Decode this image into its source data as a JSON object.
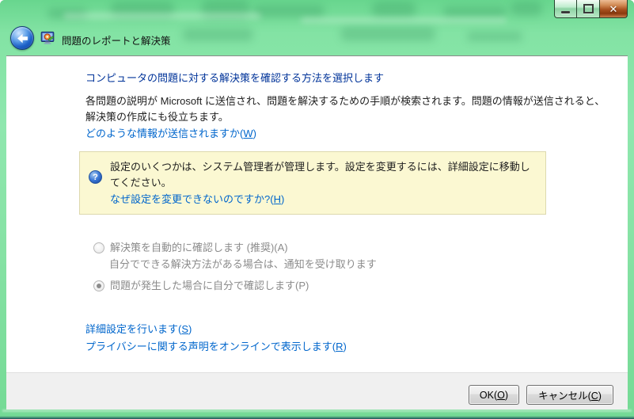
{
  "window": {
    "title": "問題のレポートと解決策",
    "icons": {
      "close_glyph": "✕",
      "help_glyph": "?"
    }
  },
  "content": {
    "heading": "コンピュータの問題に対する解決策を確認する方法を選択します",
    "body": "各問題の説明が Microsoft に送信され、問題を解決するための手順が検索されます。問題の情報が送信されると、解決策の作成にも役立ちます。",
    "what_info_link": {
      "prefix": "どのような情報が送信されますか(",
      "key": "W",
      "suffix": ")"
    },
    "admin_notice": {
      "text": "設定のいくつかは、システム管理者が管理します。設定を変更するには、詳細設定に移動してください。",
      "link": {
        "prefix": "なぜ設定を変更できないのですか?(",
        "key": "H",
        "suffix": ")"
      }
    },
    "options": [
      {
        "prefix": "解決策を自動的に確認します (推奨)(",
        "key": "A",
        "suffix": ")",
        "selected": false,
        "disabled": true,
        "description": "自分でできる解決方法がある場合は、通知を受け取ります"
      },
      {
        "prefix": "問題が発生した場合に自分で確認します(",
        "key": "P",
        "suffix": ")",
        "selected": true,
        "disabled": true
      }
    ],
    "advanced_link": {
      "prefix": "詳細設定を行います(",
      "key": "S",
      "suffix": ")"
    },
    "privacy_link": {
      "prefix": "プライバシーに関する声明をオンラインで表示します(",
      "key": "R",
      "suffix": ")"
    }
  },
  "footer": {
    "ok_button": {
      "prefix": "OK(",
      "key": "O",
      "suffix": ")"
    },
    "cancel_button": {
      "prefix": "キャンセル(",
      "key": "C",
      "suffix": ")"
    }
  },
  "colors": {
    "heading_blue": "#003399",
    "link_blue": "#0066cc",
    "glass_green": "#86e2a4",
    "notice_bg": "#fbf8d2",
    "notice_border": "#ddd9ae",
    "footer_bg": "#f0f0f0",
    "close_button_red": "#a8511f",
    "disabled_text": "#8b8b8b"
  }
}
